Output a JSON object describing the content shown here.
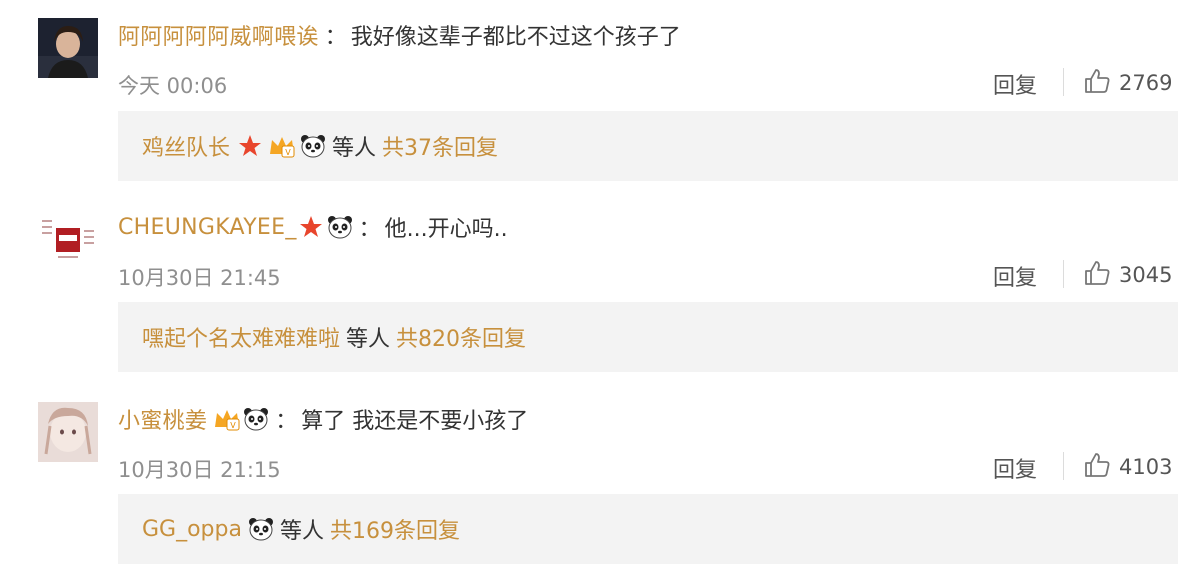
{
  "comments": [
    {
      "username": "阿阿阿阿阿威啊喂诶",
      "badges": [],
      "colon": "：",
      "text": "我好像这辈子都比不过这个孩子了",
      "time": "今天 00:06",
      "reply_label": "回复",
      "likes": "2769",
      "replies": {
        "names": "鸡丝队长",
        "badges": [
          "red-star-icon",
          "crown-vip-icon",
          "panda-icon"
        ],
        "etc": "等人",
        "total": "共37条回复"
      }
    },
    {
      "username": "CHEUNGKAYEE_",
      "badges": [
        "red-star-icon",
        "panda-icon"
      ],
      "colon": "：",
      "text": "他...开心吗..",
      "time": "10月30日 21:45",
      "reply_label": "回复",
      "likes": "3045",
      "replies": {
        "names": "嘿起个名太难难难啦",
        "badges": [],
        "etc": "等人",
        "total": "共820条回复"
      }
    },
    {
      "username": "小蜜桃姜",
      "badges": [
        "crown-vip-icon",
        "panda-icon"
      ],
      "colon": "：",
      "text": "算了 我还是不要小孩了",
      "time": "10月30日 21:15",
      "reply_label": "回复",
      "likes": "4103",
      "replies": {
        "names": "GG_oppa",
        "badges": [
          "panda-icon"
        ],
        "etc": "等人",
        "total": "共169条回复"
      }
    }
  ],
  "colors": {
    "username": "#c7903d",
    "text": "#333333",
    "meta": "#8f8f8f",
    "reply_bg": "#f3f3f3",
    "star": "#e8452c"
  }
}
